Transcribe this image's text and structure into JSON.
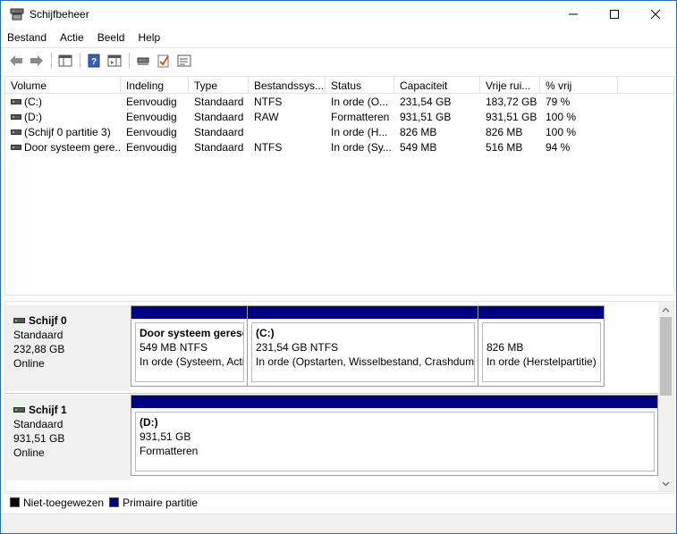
{
  "window": {
    "title": "Schijfbeheer",
    "icon": "disk-management-icon",
    "accent": "#000080"
  },
  "menu": [
    "Bestand",
    "Actie",
    "Beeld",
    "Help"
  ],
  "toolbar": {
    "buttons": [
      "back-icon",
      "forward-icon",
      "show-hide-console-tree-icon",
      "help-icon",
      "show-hide-action-pane-icon",
      "connect-disk-icon",
      "check-icon",
      "properties-icon"
    ]
  },
  "volume_list": {
    "columns": [
      "Volume",
      "Indeling",
      "Type",
      "Bestandssys...",
      "Status",
      "Capaciteit",
      "Vrije rui...",
      "% vrij"
    ],
    "rows": [
      [
        "(C:)",
        "Eenvoudig",
        "Standaard",
        "NTFS",
        "In orde (O...",
        "231,54 GB",
        "183,72 GB",
        "79 %"
      ],
      [
        "(D:)",
        "Eenvoudig",
        "Standaard",
        "RAW",
        "Formatteren",
        "931,51 GB",
        "931,51 GB",
        "100 %"
      ],
      [
        "(Schijf 0 partitie 3)",
        "Eenvoudig",
        "Standaard",
        "",
        "In orde (H...",
        "826 MB",
        "826 MB",
        "100 %"
      ],
      [
        "Door systeem gere...",
        "Eenvoudig",
        "Standaard",
        "NTFS",
        "In orde (Sy...",
        "549 MB",
        "516 MB",
        "94 %"
      ]
    ]
  },
  "disks": [
    {
      "name": "Schijf 0",
      "type": "Standaard",
      "size": "232,88 GB",
      "state": "Online",
      "partitions": [
        {
          "name": "Door systeem gerese",
          "size": "549 MB NTFS",
          "status": "In orde (Systeem, Acti"
        },
        {
          "name": "(C:)",
          "size": "231,54 GB NTFS",
          "status": "In orde (Opstarten, Wisselbestand, Crashdump"
        },
        {
          "name": "",
          "size": "826 MB",
          "status": "In orde (Herstelpartitie)"
        }
      ]
    },
    {
      "name": "Schijf 1",
      "type": "Standaard",
      "size": "931,51 GB",
      "state": "Online",
      "partitions": [
        {
          "name": "(D:)",
          "size": "931,51 GB",
          "status": "Formatteren"
        }
      ]
    }
  ],
  "legend": [
    {
      "label": "Niet-toegewezen",
      "color": "#000000"
    },
    {
      "label": "Primaire partitie",
      "color": "#000080"
    }
  ]
}
